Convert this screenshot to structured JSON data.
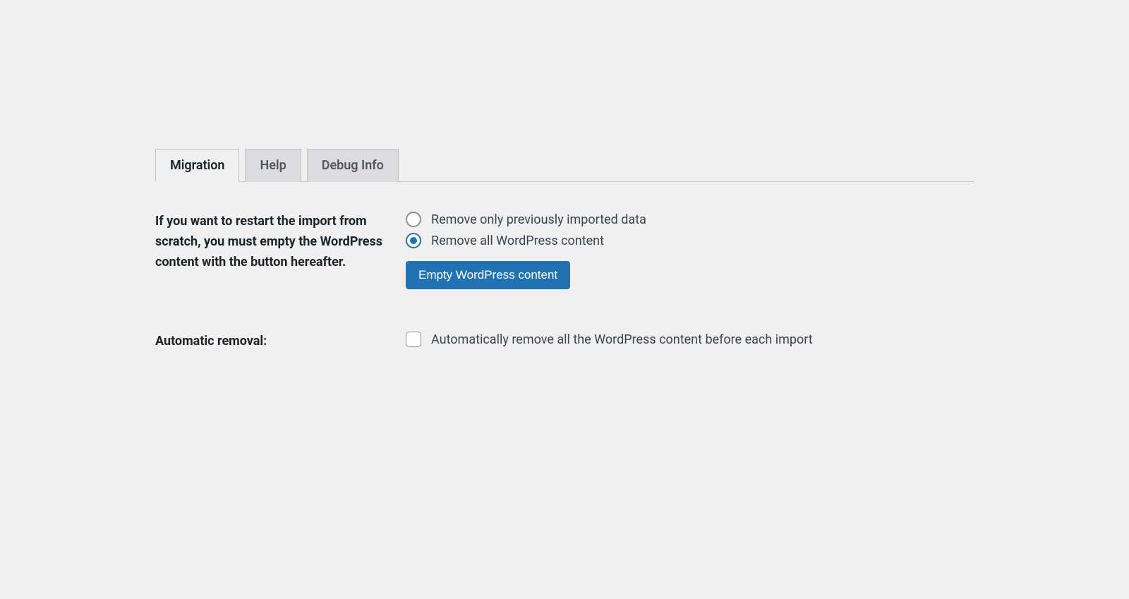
{
  "tabs": {
    "migration": "Migration",
    "help": "Help",
    "debug_info": "Debug Info",
    "active": "migration"
  },
  "restart_section": {
    "label": "If you want to restart the import from scratch, you must empty the WordPress content with the button hereafter.",
    "options": {
      "remove_previous": "Remove only previously imported data",
      "remove_all": "Remove all WordPress content",
      "selected": "remove_all"
    },
    "button": "Empty WordPress content"
  },
  "automatic_section": {
    "label": "Automatic removal:",
    "checkbox_label": "Automatically remove all the WordPress content before each import",
    "checked": false
  }
}
